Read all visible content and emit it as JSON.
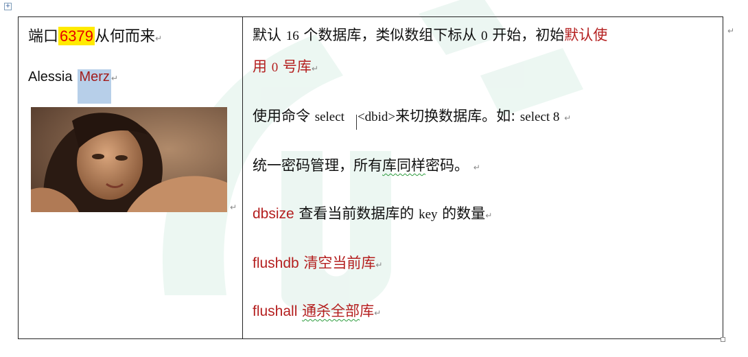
{
  "left_cell": {
    "title_prefix": "端口",
    "port": "6379",
    "title_suffix": "从何而来",
    "name_first": "Alessia",
    "name_last": "Merz",
    "photo_icon": "portrait-photo"
  },
  "right_cell": {
    "line1_a": "默认 ",
    "line1_num": "16",
    "line1_b": " 个数据库，类似数组下标从 ",
    "line1_zero": "0",
    "line1_c": " 开始，初始",
    "line1_red": "默认使",
    "line2_red_a": "用 ",
    "line2_red_zero": "0",
    "line2_red_b": " 号库",
    "line3_a": "使用命令 ",
    "line3_cmd": "select    <dbid>",
    "line3_b": "来切换数据库。如: ",
    "line3_example": "select 8",
    "line4_a": "统一密码管理，所有",
    "line4_squiggle": "库同样",
    "line4_b": "密码。",
    "line5_cmd": "dbsize",
    "line5_a": " 查看当前数据库的 ",
    "line5_key": "key",
    "line5_b": " 的数量",
    "line6_cmd": "flushdb",
    "line6_text": " 清空当前库",
    "line7_cmd": "flushall",
    "line7_a": " ",
    "line7_squiggle": "通杀全部",
    "line7_b": "库"
  },
  "marks": {
    "paragraph": "↵"
  },
  "colors": {
    "accent_red": "#b41f1f",
    "highlight_yellow": "#ffea00",
    "selection_blue": "#b7cfe9"
  }
}
